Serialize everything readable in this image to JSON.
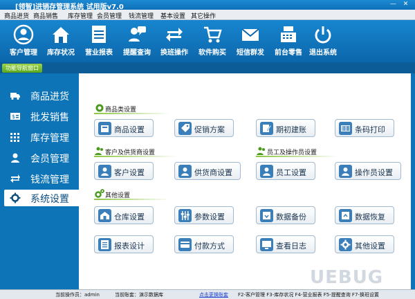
{
  "window": {
    "title": "[领智]进销存管理系统 试用版v7.0"
  },
  "menu": [
    "商品进货",
    "商品销售",
    "库存管理",
    "会员管理",
    "钱流管理",
    "基本设置",
    "其它操作"
  ],
  "toolbar": [
    {
      "label": "客户管理",
      "icon": "user-icon"
    },
    {
      "label": "库存状况",
      "icon": "home-icon"
    },
    {
      "label": "营业报表",
      "icon": "report-icon"
    },
    {
      "label": "提醒查询",
      "icon": "chat-icon"
    },
    {
      "label": "换班操作",
      "icon": "swap-icon"
    },
    {
      "label": "软件购买",
      "icon": "cart-icon"
    },
    {
      "label": "短信群发",
      "icon": "mail-icon"
    },
    {
      "label": "前台零售",
      "icon": "cash-register-icon"
    },
    {
      "label": "退出系统",
      "icon": "power-icon"
    }
  ],
  "nav": {
    "tab": "功能导航窗口"
  },
  "sidebar": [
    {
      "label": "商品进货",
      "icon": "truck-icon"
    },
    {
      "label": "批发销售",
      "icon": "sale-icon"
    },
    {
      "label": "库存管理",
      "icon": "grid-icon"
    },
    {
      "label": "会员管理",
      "icon": "member-icon"
    },
    {
      "label": "钱流管理",
      "icon": "money-icon"
    },
    {
      "label": "系统设置",
      "icon": "settings-icon",
      "active": true
    }
  ],
  "sections": {
    "goods": "商品类设置",
    "customer": "客户及供货商设置",
    "staff": "员工及操作员设置",
    "other": "其他设置"
  },
  "buttons": {
    "goods_settings": "商品设置",
    "promotion": "促销方案",
    "opening": "期初建账",
    "barcode": "条码打印",
    "customer_settings": "客户设置",
    "supplier_settings": "供货商设置",
    "staff_settings": "员工设置",
    "operator_settings": "操作员设置",
    "warehouse_settings": "仓库设置",
    "param_settings": "参数设置",
    "backup": "数据备份",
    "restore": "数据恢复",
    "report_design": "报表设计",
    "payment": "付款方式",
    "log": "查看日志",
    "other_settings": "其他设置"
  },
  "status": {
    "operator": "当前操作员：admin",
    "account": "当前账套：演示数据库",
    "switch_link": "点击更换账套",
    "hotkeys": "F2-客户管理 F3-库存状况 F4-营业报表 F5-提醒查询 F7-换班设置"
  },
  "watermark": "UEBUG",
  "colors": {
    "brand": "#0e74b8",
    "accent": "#8cc63f"
  }
}
